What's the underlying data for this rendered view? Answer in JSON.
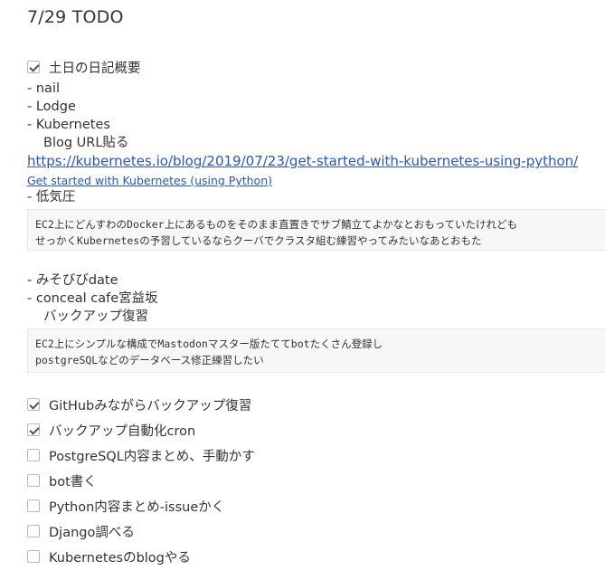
{
  "title": "7/29 TODO",
  "diary": {
    "label": "土日の日記概要",
    "checked": true,
    "items": [
      "- nail",
      "- Lodge",
      "- Kubernetes"
    ],
    "blog_line": "Blog URL貼る",
    "url": "https://kubernetes.io/blog/2019/07/23/get-started-with-kubernetes-using-python/",
    "link_title": "Get started with Kubernetes (using Python)",
    "teikiatsu": "- 低気圧",
    "code1": "EC2上にどんすわのDocker上にあるものをそのまま直置きでサブ鯖立てよかなとおもっていたけれども\nせっかくKubernetesの予習しているならクーバでクラスタ組む練習やってみたいなあとおもた",
    "misobibi": "- みそびびdate",
    "conceal": "- conceal cafe宮益坂",
    "backup": "バックアップ復習",
    "code2": "EC2上にシンプルな構成でMastodonマスター版たててbotたくさん登録し\npostgreSQLなどのデータベース修正練習したい"
  },
  "todos": [
    {
      "label": "GitHubみながらバックアップ復習",
      "checked": true
    },
    {
      "label": "バックアップ自動化cron",
      "checked": true
    },
    {
      "label": "PostgreSQL内容まとめ、手動かす",
      "checked": false
    },
    {
      "label": "bot書く",
      "checked": false
    },
    {
      "label": "Python内容まとめ-issueかく",
      "checked": false
    },
    {
      "label": "Django調べる",
      "checked": false
    },
    {
      "label": "Kubernetesのblogやる",
      "checked": false
    }
  ]
}
